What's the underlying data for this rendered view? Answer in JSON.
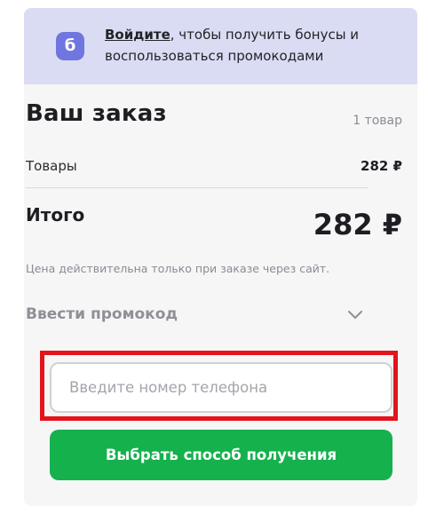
{
  "banner": {
    "icon_letter": "б",
    "link_text": "Войдите",
    "text": ", чтобы получить бонусы и воспользоваться промокодами"
  },
  "order": {
    "title": "Ваш заказ",
    "items_count": "1 товар",
    "goods_label": "Товары",
    "goods_value": "282 ₽",
    "total_label": "Итого",
    "total_value": "282 ₽",
    "note": "Цена действительна только при заказе через сайт."
  },
  "promo": {
    "label": "Ввести промокод",
    "icon": "chevron-down-icon"
  },
  "phone": {
    "placeholder": "Введите номер телефона",
    "value": ""
  },
  "submit": {
    "label": "Выбрать способ получения"
  },
  "colors": {
    "banner_bg": "#dadcf4",
    "accent_green": "#15b14d",
    "highlight_red": "#e3141b",
    "bonus_icon": "#6f76e0"
  }
}
